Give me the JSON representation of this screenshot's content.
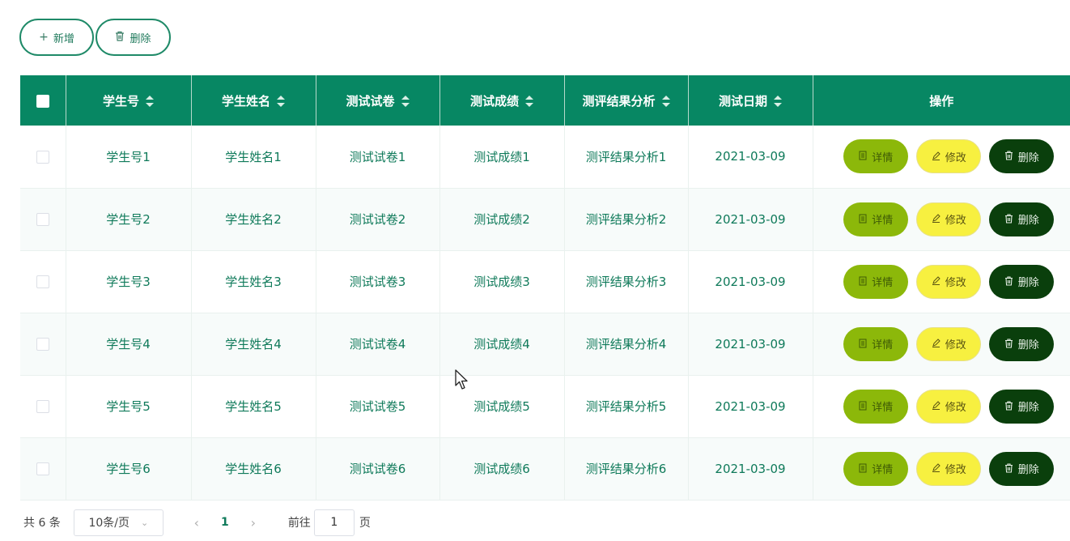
{
  "toolbar": {
    "add_label": "新增",
    "delete_label": "删除"
  },
  "table": {
    "headers": [
      "学生号",
      "学生姓名",
      "测试试卷",
      "测试成绩",
      "测评结果分析",
      "测试日期",
      "操作"
    ],
    "rows": [
      {
        "student_no": "学生号1",
        "student_name": "学生姓名1",
        "paper": "测试试卷1",
        "score": "测试成绩1",
        "analysis": "测评结果分析1",
        "date": "2021-03-09"
      },
      {
        "student_no": "学生号2",
        "student_name": "学生姓名2",
        "paper": "测试试卷2",
        "score": "测试成绩2",
        "analysis": "测评结果分析2",
        "date": "2021-03-09"
      },
      {
        "student_no": "学生号3",
        "student_name": "学生姓名3",
        "paper": "测试试卷3",
        "score": "测试成绩3",
        "analysis": "测评结果分析3",
        "date": "2021-03-09"
      },
      {
        "student_no": "学生号4",
        "student_name": "学生姓名4",
        "paper": "测试试卷4",
        "score": "测试成绩4",
        "analysis": "测评结果分析4",
        "date": "2021-03-09"
      },
      {
        "student_no": "学生号5",
        "student_name": "学生姓名5",
        "paper": "测试试卷5",
        "score": "测试成绩5",
        "analysis": "测评结果分析5",
        "date": "2021-03-09"
      },
      {
        "student_no": "学生号6",
        "student_name": "学生姓名6",
        "paper": "测试试卷6",
        "score": "测试成绩6",
        "analysis": "测评结果分析6",
        "date": "2021-03-09"
      }
    ],
    "actions": {
      "detail": "详情",
      "edit": "修改",
      "delete": "删除"
    }
  },
  "pagination": {
    "total": "共 6 条",
    "page_size": "10条/页",
    "current_page": "1",
    "goto_label": "前往",
    "goto_value": "1",
    "page_suffix": "页"
  },
  "colors": {
    "header_bg": "#078763",
    "text_accent": "#0f7a5a",
    "detail_btn": "#8cb80a",
    "edit_btn": "#f7f040",
    "delete_btn": "#0a3f0c"
  }
}
